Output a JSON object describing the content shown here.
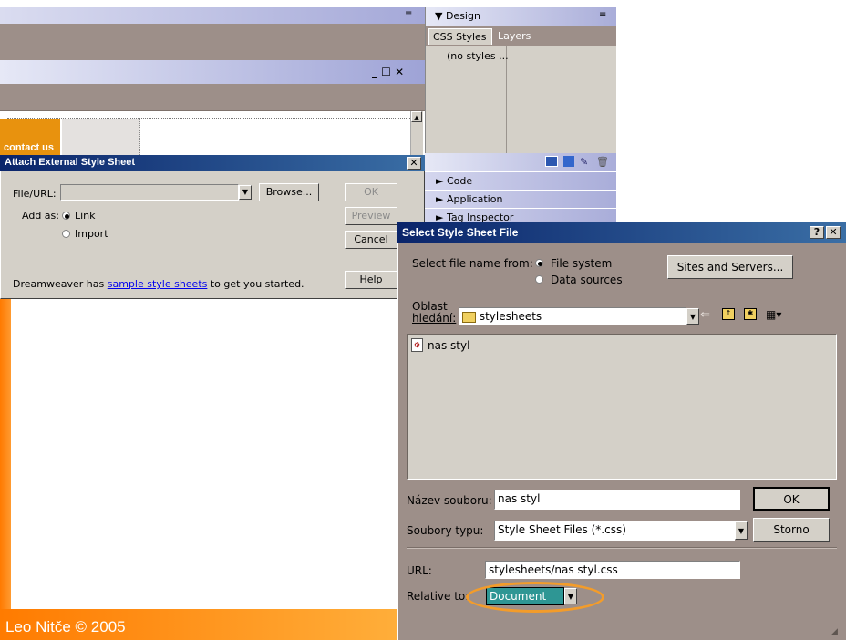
{
  "panel": {
    "design_label": "▼ Design",
    "tabs": [
      "CSS Styles",
      "Layers"
    ],
    "no_styles": "(no styles ...",
    "rows": [
      "► Code",
      "► Application",
      "► Tag Inspector"
    ]
  },
  "docwin": {
    "buttons": "_ ☐ ✕",
    "contact": "contact us"
  },
  "attach_dialog": {
    "title": "Attach External Style Sheet",
    "file_url_label": "File/URL:",
    "file_url_value": "",
    "browse_label": "Browse...",
    "add_as_label": "Add as:",
    "option_link": "Link",
    "option_import": "Import",
    "ok_label": "OK",
    "preview_label": "Preview",
    "cancel_label": "Cancel",
    "help_label": "Help",
    "note_prefix": "Dreamweaver has ",
    "note_link": "sample style sheets",
    "note_suffix": " to get you started."
  },
  "footer": {
    "copyright": "Leo Nitče © 2005"
  },
  "select_dialog": {
    "title": "Select Style Sheet File",
    "select_from_label": "Select file name from:",
    "opt_file_system": "File system",
    "opt_data_sources": "Data sources",
    "sites_button": "Sites and Servers...",
    "look_in_label_1": "Oblast",
    "look_in_label_2": "hledání:",
    "look_in_value": "stylesheets",
    "files": [
      "nas styl"
    ],
    "filename_label": "Název souboru:",
    "filename_value": "nas styl",
    "filetype_label": "Soubory typu:",
    "filetype_value": "Style Sheet Files (*.css)",
    "ok_label": "OK",
    "cancel_label": "Storno",
    "url_label": "URL:",
    "url_value": "stylesheets/nas styl.css",
    "relative_label": "Relative to:",
    "relative_value": "Document"
  }
}
